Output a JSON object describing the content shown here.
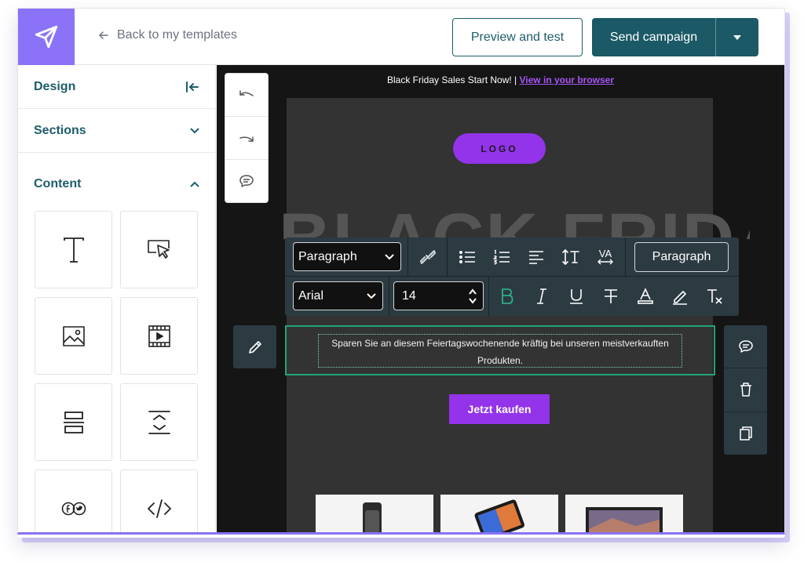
{
  "topbar": {
    "back_label": "Back to my templates",
    "preview_label": "Preview and test",
    "send_label": "Send campaign"
  },
  "sidebar": {
    "design_label": "Design",
    "sections_label": "Sections",
    "content_label": "Content",
    "tiles": [
      "text-block",
      "button-block",
      "image-block",
      "video-block",
      "divider-block",
      "spacer-block",
      "social-block",
      "html-block"
    ]
  },
  "email": {
    "preheader": "Black Friday Sales Start Now! |",
    "view_browser": "View in your browser",
    "logo": "LOGO",
    "hero_title": "BLACK FRIDAY",
    "paragraph": "Sparen Sie an diesem Feiertagswochenende kräftig bei unseren meistverkauften Produkten.",
    "cta": "Jetzt kaufen"
  },
  "toolbar": {
    "block_type": "Paragraph",
    "paragraph_button": "Paragraph",
    "font": "Arial",
    "size": "14",
    "va_label": "VA"
  },
  "colors": {
    "brand_purple": "#8b72f7",
    "teal": "#1b5966",
    "accent_purple": "#9333ea",
    "selection_green": "#24a37a"
  }
}
